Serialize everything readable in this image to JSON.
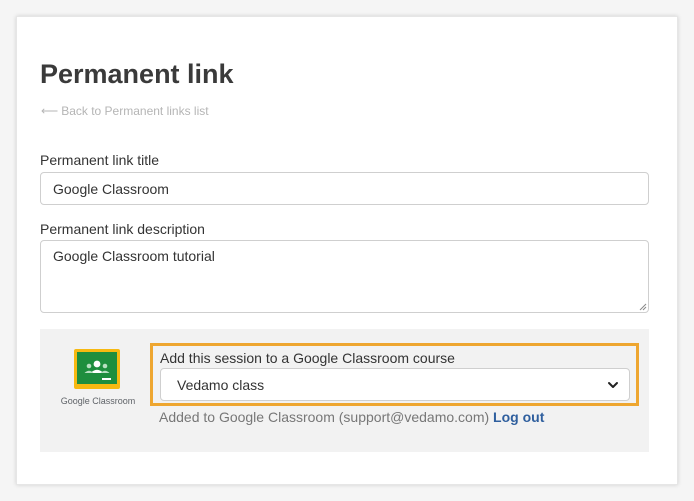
{
  "page": {
    "title": "Permanent link",
    "back_link": "Back to Permanent links list"
  },
  "form": {
    "title_label": "Permanent link title",
    "title_value": "Google Classroom",
    "description_label": "Permanent link description",
    "description_value": "Google Classroom tutorial"
  },
  "google_classroom": {
    "logo_text": "Google Classroom",
    "course_label": "Add this session to a Google Classroom course",
    "selected_course": "Vedamo class",
    "status_text": "Added to Google Classroom (support@vedamo.com)",
    "logout_label": "Log out"
  },
  "colors": {
    "highlight": "#eea630",
    "link": "#2f5f9e",
    "classroom_green": "#1e8e3e",
    "classroom_yellow": "#f6b912"
  },
  "icons": {
    "back": "arrow-left-icon",
    "select": "chevron-down-icon",
    "logo": "google-classroom-logo"
  }
}
